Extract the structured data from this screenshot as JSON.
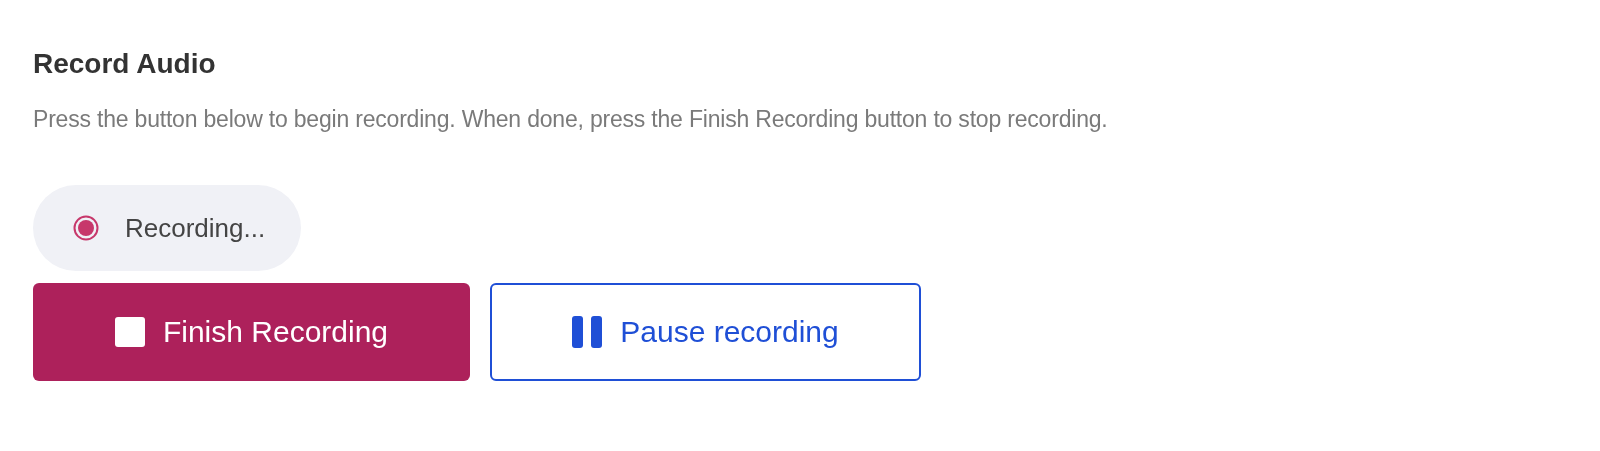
{
  "title": "Record Audio",
  "description": "Press the button below to begin recording. When done, press the Finish Recording button to stop recording.",
  "status": {
    "label": "Recording..."
  },
  "buttons": [
    {
      "label": "Finish Recording",
      "kind": "primary"
    },
    {
      "label": "Pause recording",
      "kind": "outline"
    }
  ]
}
